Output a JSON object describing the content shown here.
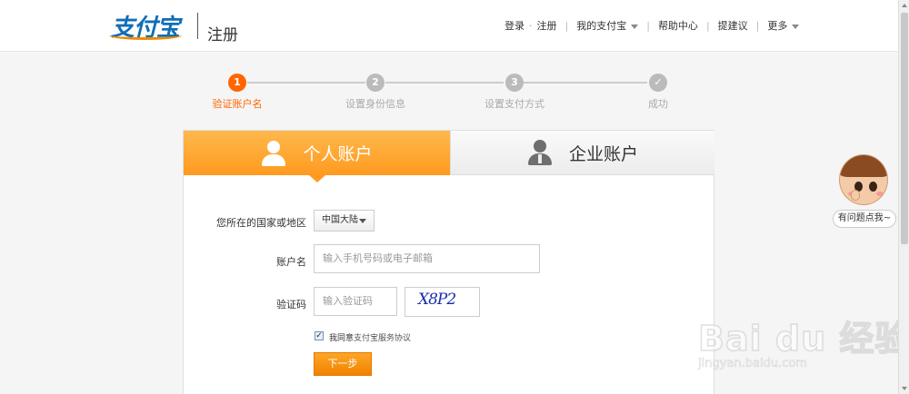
{
  "header": {
    "logo_text": "支付宝",
    "page_title": "注册",
    "nav": {
      "login": "登录",
      "register": "注册",
      "my_alipay": "我的支付宝",
      "help_center": "帮助中心",
      "suggest": "提建议",
      "more": "更多"
    }
  },
  "steps": [
    {
      "number": "1",
      "label": "验证账户名",
      "active": true
    },
    {
      "number": "2",
      "label": "设置身份信息",
      "active": false
    },
    {
      "number": "3",
      "label": "设置支付方式",
      "active": false
    },
    {
      "number": "✓",
      "label": "成功",
      "active": false
    }
  ],
  "tabs": {
    "personal": "个人账户",
    "company": "企业账户"
  },
  "form": {
    "country_label": "您所在的国家或地区",
    "country_value": "中国大陆",
    "account_label": "账户名",
    "account_placeholder": "输入手机号码或电子邮箱",
    "captcha_label": "验证码",
    "captcha_placeholder": "输入验证码",
    "captcha_image_text": "X8P2",
    "agree_text": "我同意",
    "agree_link": "支付宝服务协议",
    "agree_checked": true,
    "next_button": "下一步"
  },
  "help_widget": {
    "bubble": "有问题点我~"
  },
  "watermark": {
    "main": "Bai du 经验",
    "sub": "jingyan.baidu.com"
  },
  "colors": {
    "accent": "#ff6600",
    "tab_active": "#ff9a1f",
    "brand_blue": "#0e6eb8"
  }
}
